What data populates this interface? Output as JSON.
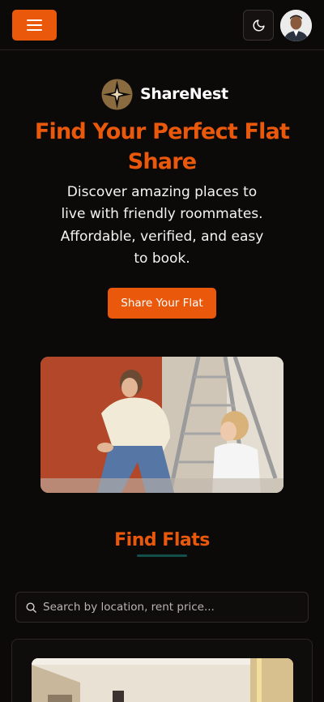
{
  "header": {
    "menu_icon": "hamburger-menu-icon",
    "theme_icon": "moon-icon",
    "avatar_icon": "user-avatar",
    "accent_color": "#ea580c"
  },
  "brand": {
    "name": "ShareNest",
    "logo_icon": "sparkle-star-logo"
  },
  "hero": {
    "title": "Find Your Perfect Flat Share",
    "subtitle": "Discover amazing places to live with friendly roommates. Affordable, verified, and easy to book.",
    "cta_label": "Share Your Flat",
    "image": "woman-and-child-painting-wall-photo"
  },
  "find_flats": {
    "title": "Find Flats",
    "search_placeholder": "Search by location, rent price...",
    "search_icon": "search-icon",
    "first_card_image": "apartment-interior-photo"
  }
}
